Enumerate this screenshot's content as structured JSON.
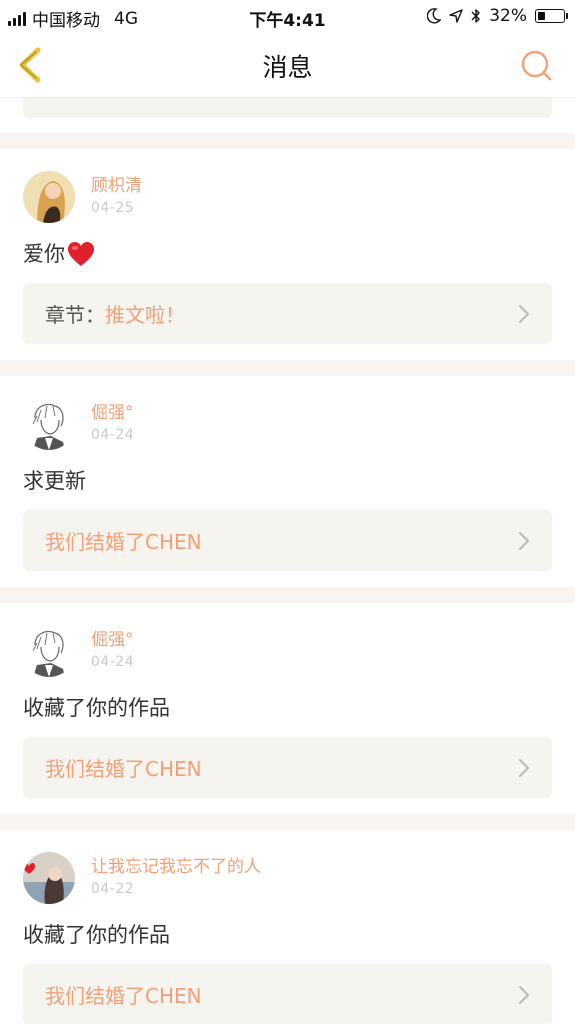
{
  "status_bar": {
    "carrier": "中国移动",
    "network": "4G",
    "time": "下午4:41",
    "battery_percent": "32%",
    "battery_level": 0.32
  },
  "nav": {
    "title": "消息",
    "back_icon": "chevron-left-icon",
    "search_icon": "search-icon"
  },
  "colors": {
    "accent": "#f3a077",
    "back_icon": "#e9c23a",
    "card_inner_bg": "#f6f4ef",
    "divider": "#f7f4f1"
  },
  "messages": [
    {
      "username": "顾枳清",
      "date": "04-25",
      "content": "爱你",
      "has_heart": true,
      "chapter_prefix": "章节：",
      "chapter_title": "推文啦！"
    },
    {
      "username": "倔强°",
      "date": "04-24",
      "content": "求更新",
      "chapter_prefix": "",
      "chapter_title": "我们结婚了CHEN"
    },
    {
      "username": "倔强°",
      "date": "04-24",
      "content": "收藏了你的作品",
      "chapter_prefix": "",
      "chapter_title": "我们结婚了CHEN"
    },
    {
      "username": "让我忘记我忘不了的人",
      "date": "04-22",
      "content": "收藏了你的作品",
      "chapter_prefix": "",
      "chapter_title": "我们结婚了CHEN"
    }
  ]
}
